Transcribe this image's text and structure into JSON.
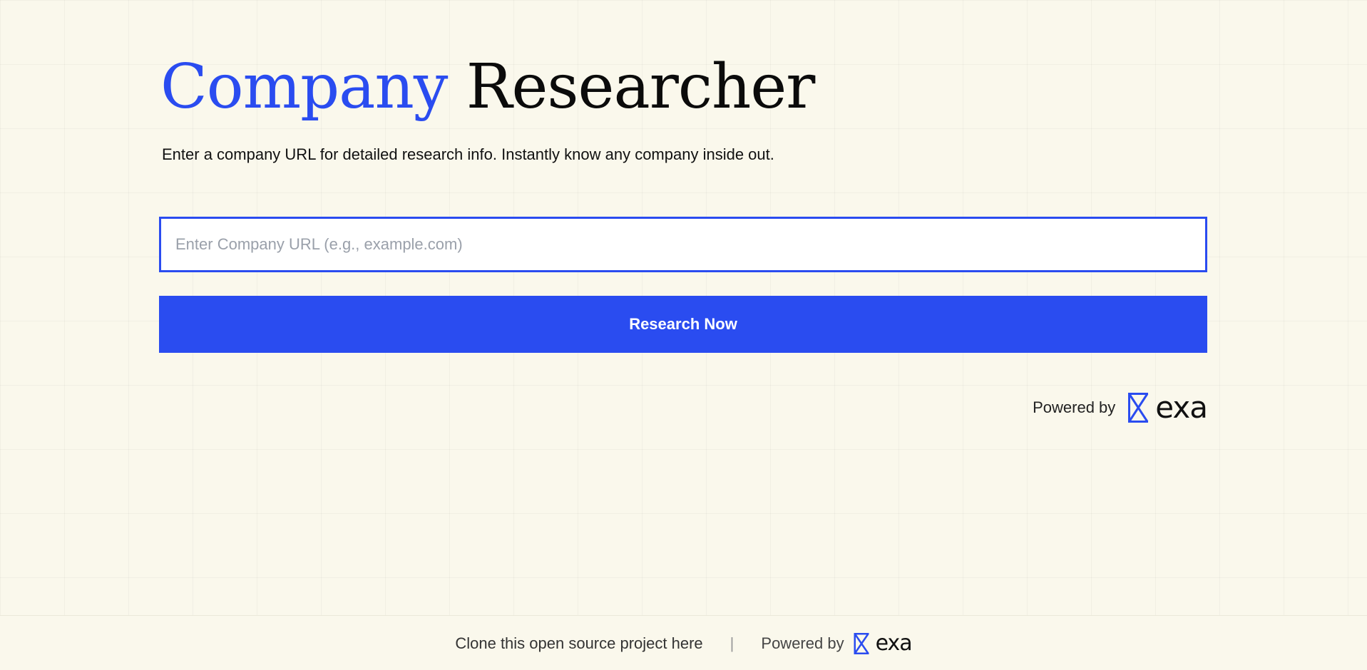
{
  "header": {
    "title_accent": "Company",
    "title_rest": "Researcher",
    "subtitle": "Enter a company URL for detailed research info. Instantly know any company inside out."
  },
  "form": {
    "url_placeholder": "Enter Company URL (e.g., example.com)",
    "url_value": "",
    "submit_label": "Research Now"
  },
  "powered": {
    "label": "Powered by",
    "brand": "exa",
    "brand_icon": "exa-logo-icon"
  },
  "footer": {
    "clone_link": "Clone this open source project here",
    "separator": "|",
    "powered_label": "Powered by",
    "brand": "exa"
  },
  "colors": {
    "accent": "#2a4cf0",
    "background": "#faf8ec",
    "text": "#111111",
    "placeholder": "#9aa0aa"
  }
}
